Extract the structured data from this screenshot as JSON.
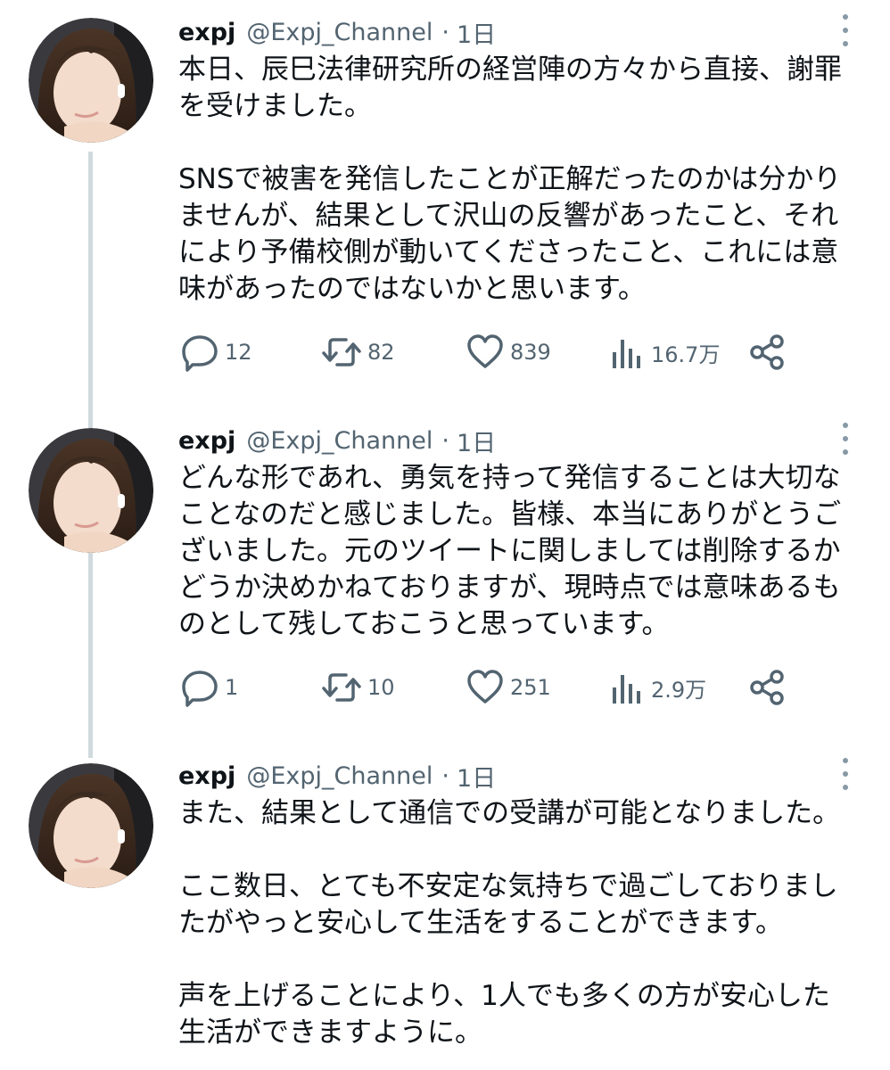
{
  "tweets": [
    {
      "name": "expj",
      "handle": "@Expj_Channel",
      "separator": "·",
      "time": "1日",
      "paragraphs": [
        "本日、辰巳法律研究所の経営陣の方々から直接、謝罪を受けました。",
        "SNSで被害を発信したことが正解だったのかは分かりませんが、結果として沢山の反響があったこと、それにより予備校側が動いてくださったこと、これには意味があったのではないかと思います。"
      ],
      "replies": "12",
      "retweets": "82",
      "likes": "839",
      "views": "16.7万"
    },
    {
      "name": "expj",
      "handle": "@Expj_Channel",
      "separator": "·",
      "time": "1日",
      "paragraphs": [
        "どんな形であれ、勇気を持って発信することは大切なことなのだと感じました。皆様、本当にありがとうございました。元のツイートに関しましては削除するかどうか決めかねておりますが、現時点では意味あるものとして残しておこうと思っています。"
      ],
      "replies": "1",
      "retweets": "10",
      "likes": "251",
      "views": "2.9万"
    },
    {
      "name": "expj",
      "handle": "@Expj_Channel",
      "separator": "·",
      "time": "1日",
      "paragraphs": [
        "また、結果として通信での受講が可能となりました。",
        "ここ数日、とても不安定な気持ちで過ごしておりましたがやっと安心して生活をすることができます。",
        "声を上げることにより、1人でも多くの方が安心した生活ができますように。"
      ]
    }
  ],
  "icons": {
    "reply": "speech-bubble-icon",
    "retweet": "retweet-arrows-icon",
    "like": "heart-icon",
    "views": "bar-chart-icon",
    "share": "share-nodes-icon",
    "more": "vertical-dots-icon"
  }
}
